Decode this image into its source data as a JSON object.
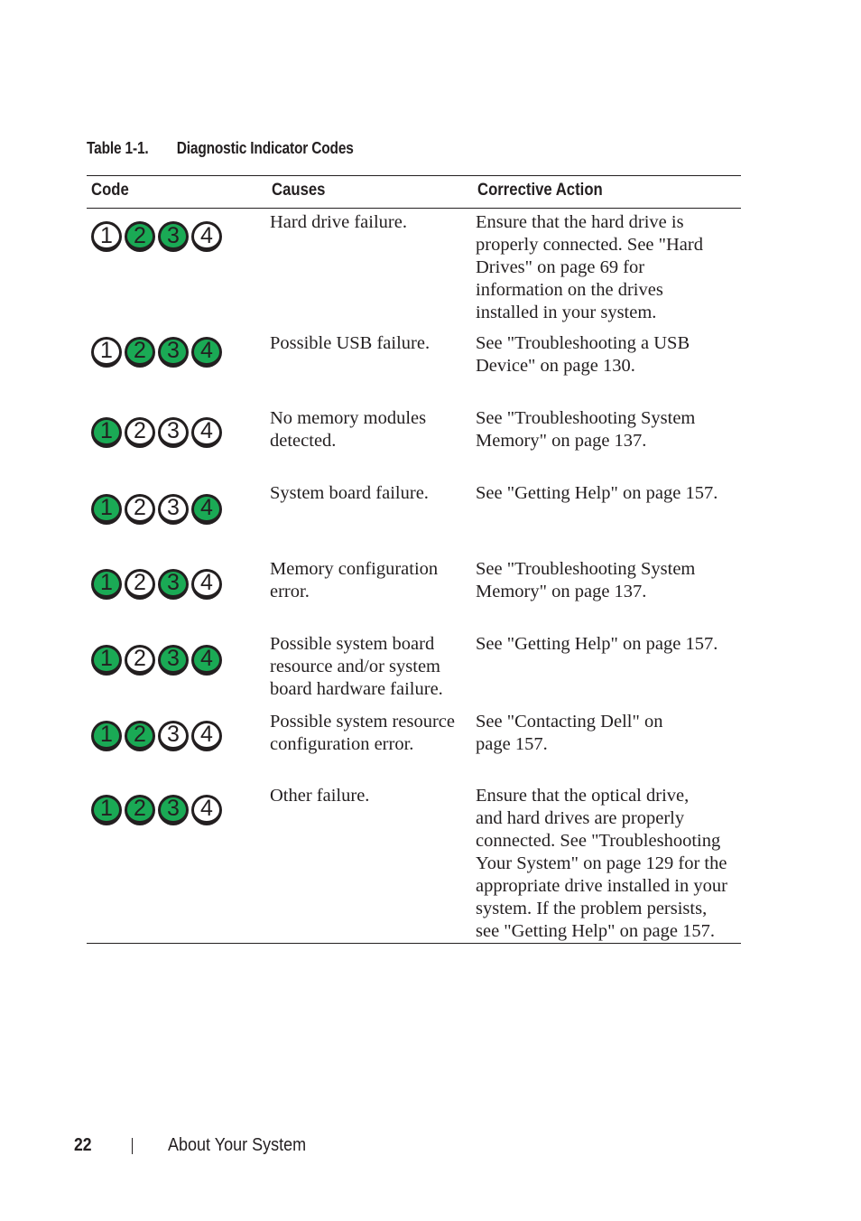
{
  "table": {
    "caption_label": "Table 1-1.",
    "caption_title": "Diagnostic Indicator Codes",
    "headers": [
      "Code",
      "Causes",
      "Corrective Action"
    ],
    "led_on_color": "#1aaa55",
    "rows": [
      {
        "leds": [
          false,
          true,
          true,
          false
        ],
        "cause": "Hard drive failure.",
        "action": [
          "Ensure that the hard drive is",
          "properly connected. See \"Hard",
          "Drives\" on page 69 for",
          "information on the drives",
          "installed in your system."
        ]
      },
      {
        "leds": [
          false,
          true,
          true,
          true
        ],
        "cause": "Possible USB failure.",
        "action": [
          "See \"Troubleshooting a USB",
          "Device\" on page 130."
        ]
      },
      {
        "leds": [
          true,
          false,
          false,
          false
        ],
        "cause": [
          "No memory modules",
          "detected."
        ],
        "action": [
          "See \"Troubleshooting System",
          "Memory\" on page 137."
        ]
      },
      {
        "leds": [
          true,
          false,
          false,
          true
        ],
        "cause": "System board failure.",
        "action": "See \"Getting Help\" on page 157."
      },
      {
        "leds": [
          true,
          false,
          true,
          false
        ],
        "cause": [
          "Memory configuration",
          "error."
        ],
        "action": [
          "See \"Troubleshooting System",
          "Memory\" on page 137."
        ]
      },
      {
        "leds": [
          true,
          false,
          true,
          true
        ],
        "cause": [
          "Possible system board",
          "resource and/or system",
          "board hardware failure."
        ],
        "action": "See \"Getting Help\" on page 157."
      },
      {
        "leds": [
          true,
          true,
          false,
          false
        ],
        "cause": [
          "Possible system resource",
          "configuration error."
        ],
        "action": [
          "See \"Contacting Dell\" on",
          "page 157."
        ]
      },
      {
        "leds": [
          true,
          true,
          true,
          false
        ],
        "cause": "Other failure.",
        "action": [
          "Ensure that the optical drive,",
          "and hard drives are properly",
          "connected. See \"Troubleshooting",
          "Your System\" on page 129 for the",
          "appropriate drive installed in your",
          "system. If the problem persists,",
          "see \"Getting Help\" on page 157."
        ]
      }
    ]
  },
  "footer": {
    "page_number": "22",
    "section": "About Your System"
  }
}
